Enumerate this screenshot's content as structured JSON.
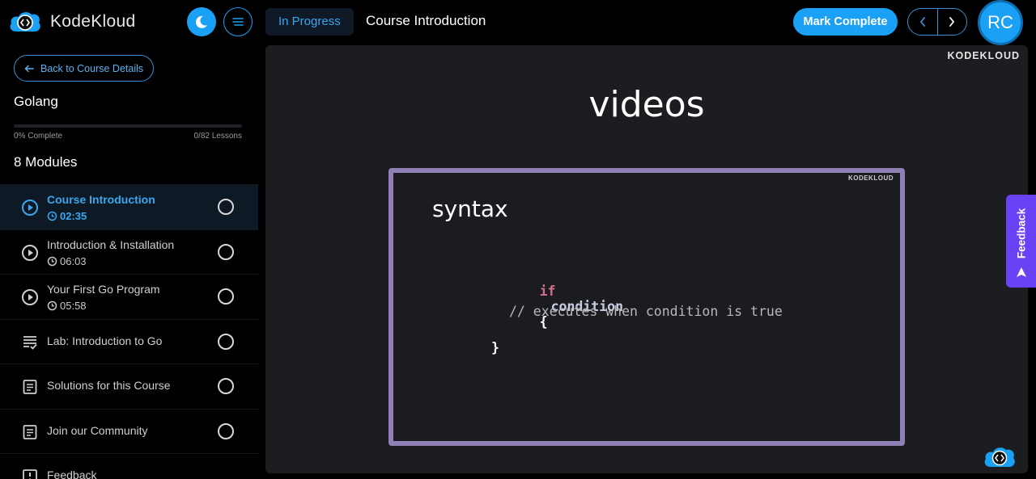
{
  "brand": {
    "name": "KodeKloud"
  },
  "header": {
    "status": "In Progress",
    "lesson_title": "Course Introduction",
    "mark_complete_label": "Mark Complete",
    "avatar_initials": "RC"
  },
  "sidebar": {
    "back_label": "Back to Course Details",
    "course_name": "Golang",
    "progress": {
      "fraction": 0,
      "percent_label": "0% Complete",
      "lessons_label": "0/82 Lessons"
    },
    "modules_heading": "8 Modules",
    "items": [
      {
        "title": "Course Introduction",
        "duration": "02:35",
        "icon": "play-circle-icon",
        "active": true
      },
      {
        "title": "Introduction & Installation",
        "duration": "06:03",
        "icon": "play-circle-icon",
        "active": false
      },
      {
        "title": "Your First Go Program",
        "duration": "05:58",
        "icon": "play-circle-icon",
        "active": false
      },
      {
        "title": "Lab: Introduction to Go",
        "duration": "",
        "icon": "lab-checklist-icon",
        "active": false
      },
      {
        "title": "Solutions for this Course",
        "duration": "",
        "icon": "document-icon",
        "active": false
      },
      {
        "title": "Join our Community",
        "duration": "",
        "icon": "document-icon",
        "active": false
      },
      {
        "title": "Feedback",
        "duration": "",
        "icon": "feedback-alert-icon",
        "active": false
      }
    ]
  },
  "video": {
    "watermark": "KODEKLOUD",
    "slide_title": "videos",
    "box_watermark": "KODEKLOUD",
    "code_heading": "syntax",
    "code": {
      "keyword": "if",
      "condition": "condition",
      "open_brace": "{",
      "comment": "// executes when condition is true",
      "close_brace": "}"
    }
  },
  "feedback_tab": {
    "label": "Feedback"
  },
  "colors": {
    "accent": "#1aa1f5",
    "feedback": "#6a42f5",
    "slide_border": "#8f7fb5"
  }
}
